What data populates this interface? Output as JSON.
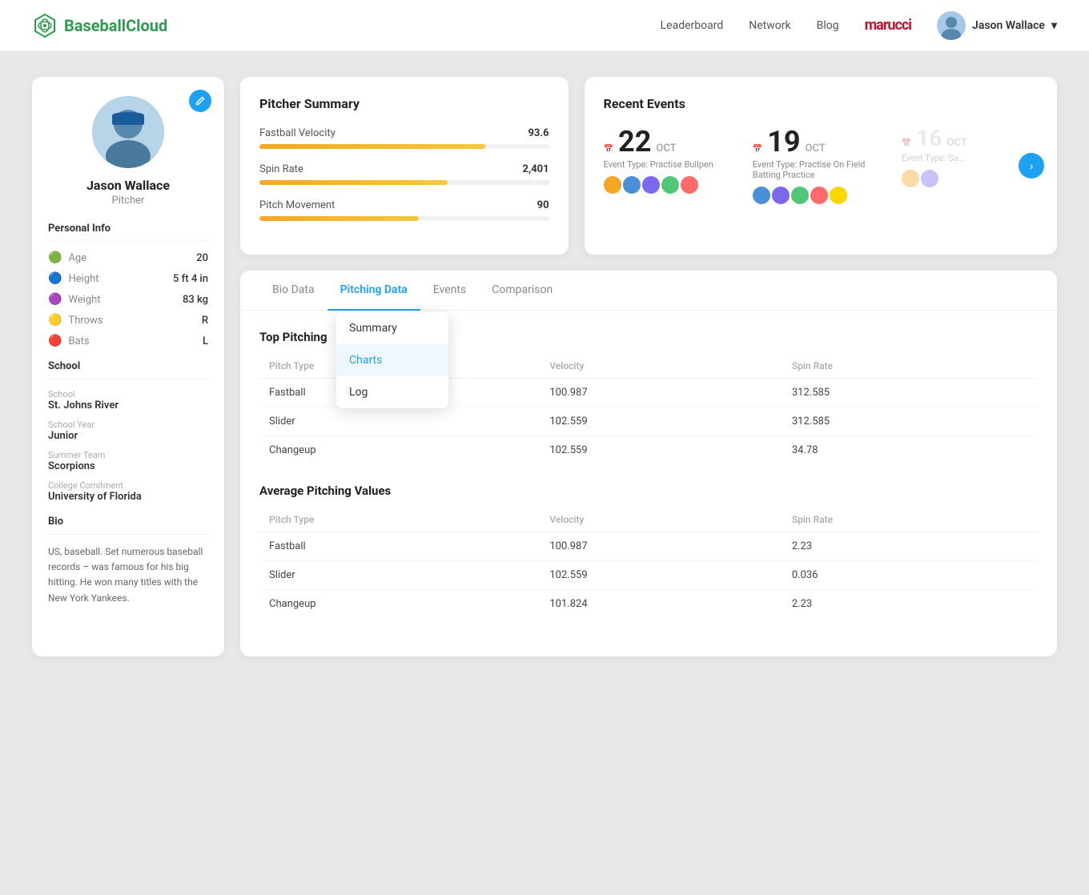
{
  "brand": {
    "name": "BaseballCloud",
    "logo_text": "⬡"
  },
  "nav": {
    "links": [
      "Leaderboard",
      "Network",
      "Blog"
    ],
    "sponsor": "marucci",
    "user_name": "Jason Wallace",
    "user_dropdown": "▾"
  },
  "profile": {
    "name": "Jason Wallace",
    "position": "Pitcher",
    "edit_icon": "✏",
    "personal_info_title": "Personal Info",
    "fields": [
      {
        "icon": "🟢",
        "label": "Age",
        "value": "20"
      },
      {
        "icon": "🔵",
        "label": "Height",
        "value": "5 ft 4 in"
      },
      {
        "icon": "🟣",
        "label": "Weight",
        "value": "83 kg"
      },
      {
        "icon": "🟡",
        "label": "Throws",
        "value": "R"
      },
      {
        "icon": "🔴",
        "label": "Bats",
        "value": "L"
      }
    ],
    "school_title": "School",
    "school_fields": [
      {
        "label": "School",
        "value": "St. Johns River"
      },
      {
        "label": "School Year",
        "value": "Junior"
      },
      {
        "label": "Summer Team",
        "value": "Scorpions"
      },
      {
        "label": "College Comitment",
        "value": "University of Florida"
      }
    ],
    "bio_title": "Bio",
    "bio_text": "US, baseball. Set numerous baseball records – was famous for his big hitting. He won many titles with the New York Yankees."
  },
  "pitcher_summary": {
    "title": "Pitcher Summary",
    "stats": [
      {
        "label": "Fastball Velocity",
        "value": "93.6",
        "pct": 78
      },
      {
        "label": "Spin Rate",
        "value": "2,401",
        "pct": 65
      },
      {
        "label": "Pitch Movement",
        "value": "90",
        "pct": 55
      }
    ]
  },
  "recent_events": {
    "title": "Recent Events",
    "events": [
      {
        "day": "22",
        "month": "OCT",
        "type": "Event Type: Practise Bullpen",
        "avatars": [
          "av1",
          "av2",
          "av3",
          "av4",
          "av5"
        ],
        "faded": false
      },
      {
        "day": "19",
        "month": "OCT",
        "type": "Event Type: Practise On Field Batting Practice",
        "avatars": [
          "av2",
          "av3",
          "av4",
          "av5",
          "av6"
        ],
        "faded": false
      },
      {
        "day": "16",
        "month": "OCT",
        "type": "Event Type: Sa...",
        "avatars": [
          "av1",
          "av3"
        ],
        "faded": true
      }
    ]
  },
  "data_card": {
    "tabs": [
      "Bio Data",
      "Pitching Data",
      "Events",
      "Comparison"
    ],
    "active_tab": "Pitching Data",
    "dropdown": {
      "items": [
        "Summary",
        "Charts",
        "Log"
      ],
      "active": "Charts"
    },
    "top_pitching_title": "Top Pitching",
    "top_pitching_headers": [
      "Pitch Type",
      "Velocity",
      "Spin Rate"
    ],
    "top_pitching_rows": [
      [
        "Fastball",
        "100.987",
        "312.585"
      ],
      [
        "Slider",
        "102.559",
        "312.585"
      ],
      [
        "Changeup",
        "102.559",
        "34.78"
      ]
    ],
    "avg_pitching_title": "Average Pitching Values",
    "avg_pitching_headers": [
      "Pitch Type",
      "Velocity",
      "Spin Rate"
    ],
    "avg_pitching_rows": [
      [
        "Fastball",
        "100.987",
        "2.23"
      ],
      [
        "Slider",
        "102.559",
        "0.036"
      ],
      [
        "Changeup",
        "101.824",
        "2.23"
      ]
    ]
  }
}
